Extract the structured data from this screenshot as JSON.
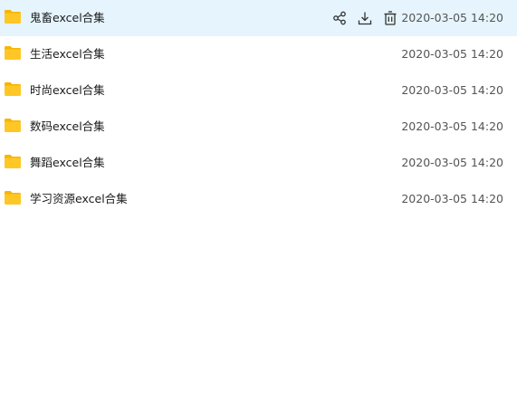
{
  "files": [
    {
      "name": "鬼畜excel合集",
      "modified": "2020-03-05 14:20",
      "type_icon": "folder-icon"
    },
    {
      "name": "生活excel合集",
      "modified": "2020-03-05 14:20",
      "type_icon": "folder-icon"
    },
    {
      "name": "时尚excel合集",
      "modified": "2020-03-05 14:20",
      "type_icon": "folder-icon"
    },
    {
      "name": "数码excel合集",
      "modified": "2020-03-05 14:20",
      "type_icon": "folder-icon"
    },
    {
      "name": "舞蹈excel合集",
      "modified": "2020-03-05 14:20",
      "type_icon": "folder-icon"
    },
    {
      "name": "学习资源excel合集",
      "modified": "2020-03-05 14:20",
      "type_icon": "folder-icon"
    }
  ],
  "row_actions": {
    "share_icon": "share-icon",
    "download_icon": "download-icon",
    "delete_icon": "trash-icon"
  },
  "colors": {
    "hover_row_background": "#e5f4fd",
    "folder_yellow": "#ffc726",
    "folder_tab_yellow": "#f7b500",
    "text_primary": "#1a1a1a",
    "text_secondary": "#555555",
    "icon_color": "#333333"
  }
}
